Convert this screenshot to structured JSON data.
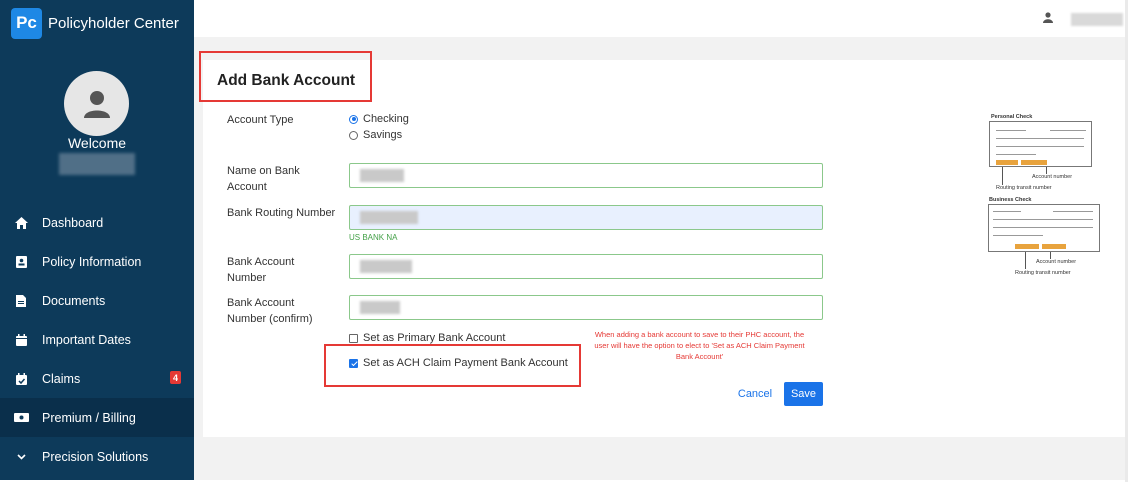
{
  "app": {
    "logo": "Pc",
    "title": "Policyholder Center"
  },
  "sidebar": {
    "welcome": "Welcome",
    "items": [
      {
        "label": "Dashboard",
        "icon": "home-icon"
      },
      {
        "label": "Policy Information",
        "icon": "id-card-icon"
      },
      {
        "label": "Documents",
        "icon": "document-icon"
      },
      {
        "label": "Important Dates",
        "icon": "calendar-icon"
      },
      {
        "label": "Claims",
        "icon": "calendar-check-icon",
        "badge": "4"
      },
      {
        "label": "Premium / Billing",
        "icon": "money-icon",
        "active": true
      },
      {
        "label": "Precision Solutions",
        "icon": "chevron-down-icon"
      }
    ]
  },
  "form": {
    "title": "Add Bank Account",
    "account_type_label": "Account Type",
    "account_types": [
      {
        "label": "Checking",
        "selected": true
      },
      {
        "label": "Savings",
        "selected": false
      }
    ],
    "name_label": "Name on Bank Account",
    "routing_label": "Bank Routing Number",
    "bank_name": "US BANK NA",
    "account_number_label": "Bank Account Number",
    "account_confirm_label": "Bank Account Number (confirm)",
    "primary_checkbox": {
      "label": "Set as Primary Bank Account",
      "checked": false
    },
    "ach_checkbox": {
      "label": "Set as ACH Claim Payment Bank Account",
      "checked": true
    },
    "note": "When adding a bank account to save to their PHC account, the user will have the option to elect to 'Set as ACH Claim Payment Bank Account'",
    "cancel_label": "Cancel",
    "save_label": "Save"
  },
  "illustration": {
    "personal_title": "Personal Check",
    "business_title": "Business Check",
    "account_number": "Account number",
    "routing_number": "Routing transit number"
  },
  "colors": {
    "sidebar": "#0d3a5a",
    "accent": "#1a73e8",
    "highlight": "#e53935",
    "field_border": "#8bc88b"
  }
}
